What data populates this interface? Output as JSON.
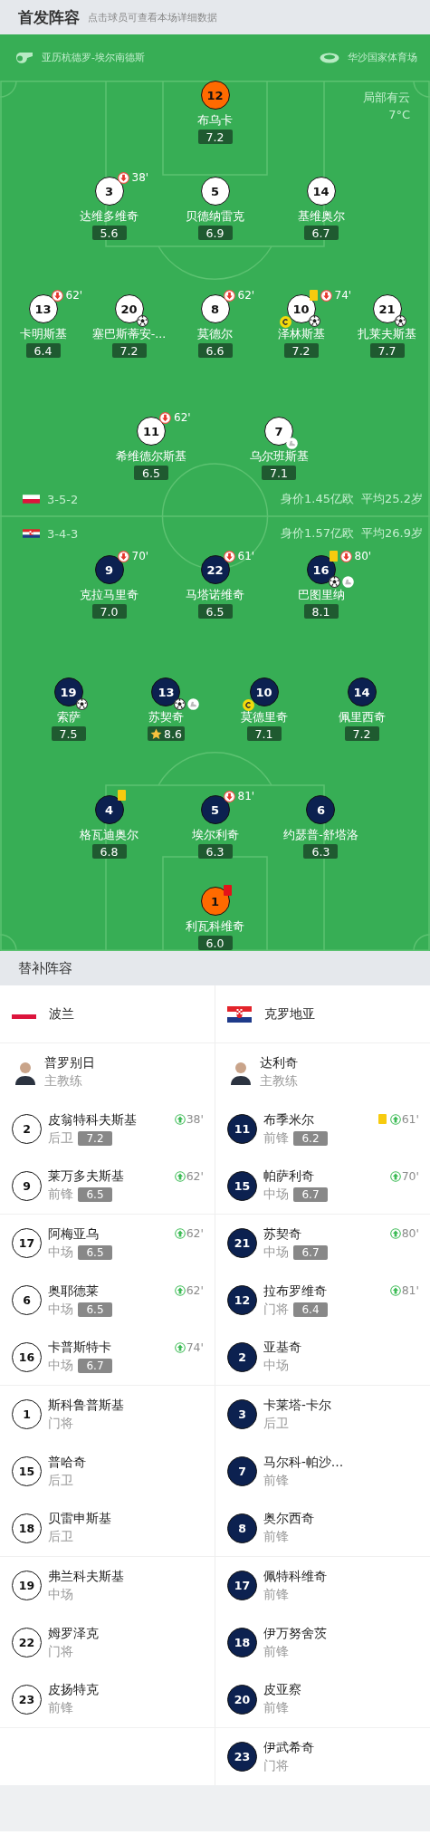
{
  "header": {
    "title": "首发阵容",
    "hint": "点击球员可查看本场详细数据"
  },
  "match_info": {
    "referee": "亚历杭德罗-埃尔南德斯",
    "stadium": "华沙国家体育场",
    "weather": "局部有云",
    "temperature": "7°C"
  },
  "teams": [
    {
      "kind": "home",
      "flag": {
        "kind": "poland"
      },
      "name": "波兰",
      "formation": "3-5-2",
      "value": "身价1.45亿欧",
      "avg_age": "平均25.2岁",
      "lines": [
        [
          {
            "number": "12",
            "name": "布乌卡",
            "rating": "7.2",
            "kind": "goalkeeper",
            "captain": false,
            "best": false
          }
        ],
        [
          {
            "number": "3",
            "name": "达维多维奇",
            "rating": "5.6",
            "kind": "outfield",
            "captain": false,
            "best": false,
            "events": [
              {
                "kind": "sub_off",
                "minute": "38'"
              }
            ]
          },
          {
            "number": "5",
            "name": "贝德纳雷克",
            "rating": "6.9",
            "kind": "outfield",
            "captain": false,
            "best": false
          },
          {
            "number": "14",
            "name": "基维奥尔",
            "rating": "6.7",
            "kind": "outfield",
            "captain": false,
            "best": false
          }
        ],
        [
          {
            "number": "13",
            "name": "卡明斯基",
            "rating": "6.4",
            "kind": "outfield",
            "captain": false,
            "best": false,
            "events": [
              {
                "kind": "sub_off",
                "minute": "62'"
              }
            ]
          },
          {
            "number": "20",
            "name": "塞巴斯蒂安-...",
            "rating": "7.2",
            "kind": "outfield",
            "captain": false,
            "best": false,
            "marks": [
              {
                "kind": "goal"
              }
            ]
          },
          {
            "number": "8",
            "name": "莫德尔",
            "rating": "6.6",
            "kind": "outfield",
            "captain": false,
            "best": false,
            "events": [
              {
                "kind": "sub_off",
                "minute": "62'"
              }
            ]
          },
          {
            "number": "10",
            "name": "泽林斯基",
            "rating": "7.2",
            "kind": "outfield",
            "captain": true,
            "best": false,
            "events": [
              {
                "kind": "yellow_card"
              },
              {
                "kind": "sub_off",
                "minute": "74'"
              }
            ],
            "marks": [
              {
                "kind": "goal"
              }
            ]
          },
          {
            "number": "21",
            "name": "扎莱夫斯基",
            "rating": "7.7",
            "kind": "outfield",
            "captain": false,
            "best": false,
            "marks": [
              {
                "kind": "goal"
              }
            ]
          }
        ],
        [
          {
            "number": "11",
            "name": "希维德尔斯基",
            "rating": "6.5",
            "kind": "outfield",
            "captain": false,
            "best": false,
            "events": [
              {
                "kind": "sub_off",
                "minute": "62'"
              }
            ]
          },
          {
            "number": "7",
            "name": "乌尔班斯基",
            "rating": "7.1",
            "kind": "outfield",
            "captain": false,
            "best": false,
            "marks": [
              {
                "kind": "assist"
              }
            ]
          }
        ]
      ],
      "coach": {
        "name": "普罗别日",
        "role": "主教练"
      },
      "subs": [
        {
          "number": "2",
          "name": "皮翁特科夫斯基",
          "position": "后卫",
          "rating": "7.2",
          "events": [
            {
              "kind": "sub_on",
              "minute": "38'"
            }
          ]
        },
        {
          "number": "9",
          "name": "莱万多夫斯基",
          "position": "前锋",
          "rating": "6.5",
          "events": [
            {
              "kind": "sub_on",
              "minute": "62'"
            }
          ]
        },
        {
          "number": "17",
          "name": "阿梅亚乌",
          "position": "中场",
          "rating": "6.5",
          "events": [
            {
              "kind": "sub_on",
              "minute": "62'"
            }
          ]
        },
        {
          "number": "6",
          "name": "奥耶德莱",
          "position": "中场",
          "rating": "6.5",
          "events": [
            {
              "kind": "sub_on",
              "minute": "62'"
            }
          ]
        },
        {
          "number": "16",
          "name": "卡普斯特卡",
          "position": "中场",
          "rating": "6.7",
          "events": [
            {
              "kind": "sub_on",
              "minute": "74'"
            }
          ]
        },
        {
          "number": "1",
          "name": "斯科鲁普斯基",
          "position": "门将"
        },
        {
          "number": "15",
          "name": "普哈奇",
          "position": "后卫"
        },
        {
          "number": "18",
          "name": "贝雷申斯基",
          "position": "后卫"
        },
        {
          "number": "19",
          "name": "弗兰科夫斯基",
          "position": "中场"
        },
        {
          "number": "22",
          "name": "姆罗泽克",
          "position": "门将"
        },
        {
          "number": "23",
          "name": "皮扬特克",
          "position": "前锋"
        }
      ]
    },
    {
      "kind": "away",
      "flag": {
        "kind": "croatia"
      },
      "name": "克罗地亚",
      "formation": "3-4-3",
      "value": "身价1.57亿欧",
      "avg_age": "平均26.9岁",
      "lines": [
        [
          {
            "number": "9",
            "name": "克拉马里奇",
            "rating": "7.0",
            "kind": "outfield",
            "captain": false,
            "best": false,
            "events": [
              {
                "kind": "sub_off",
                "minute": "70'"
              }
            ]
          },
          {
            "number": "22",
            "name": "马塔诺维奇",
            "rating": "6.5",
            "kind": "outfield",
            "captain": false,
            "best": false,
            "events": [
              {
                "kind": "sub_off",
                "minute": "61'"
              }
            ]
          },
          {
            "number": "16",
            "name": "巴图里纳",
            "rating": "8.1",
            "kind": "outfield",
            "captain": false,
            "best": false,
            "events": [
              {
                "kind": "yellow_card"
              },
              {
                "kind": "sub_off",
                "minute": "80'"
              }
            ],
            "marks": [
              {
                "kind": "goal"
              },
              {
                "kind": "assist"
              }
            ]
          }
        ],
        [
          {
            "number": "19",
            "name": "索萨",
            "rating": "7.5",
            "kind": "outfield",
            "captain": false,
            "best": false,
            "marks": [
              {
                "kind": "goal"
              }
            ]
          },
          {
            "number": "13",
            "name": "苏契奇",
            "rating": "8.6",
            "kind": "outfield",
            "captain": false,
            "best": true,
            "marks": [
              {
                "kind": "goal"
              },
              {
                "kind": "assist"
              }
            ]
          },
          {
            "number": "10",
            "name": "莫德里奇",
            "rating": "7.1",
            "kind": "outfield",
            "captain": true,
            "best": false
          },
          {
            "number": "14",
            "name": "佩里西奇",
            "rating": "7.2",
            "kind": "outfield",
            "captain": false,
            "best": false
          }
        ],
        [
          {
            "number": "4",
            "name": "格瓦迪奥尔",
            "rating": "6.8",
            "kind": "outfield",
            "captain": false,
            "best": false,
            "events": [
              {
                "kind": "yellow_card"
              }
            ]
          },
          {
            "number": "5",
            "name": "埃尔利奇",
            "rating": "6.3",
            "kind": "outfield",
            "captain": false,
            "best": false,
            "events": [
              {
                "kind": "sub_off",
                "minute": "81'"
              }
            ]
          },
          {
            "number": "6",
            "name": "约瑟普-舒塔洛",
            "rating": "6.3",
            "kind": "outfield",
            "captain": false,
            "best": false
          }
        ],
        [
          {
            "number": "1",
            "name": "利瓦科维奇",
            "rating": "6.0",
            "kind": "goalkeeper",
            "captain": false,
            "best": false,
            "events": [
              {
                "kind": "red_card"
              }
            ]
          }
        ]
      ],
      "coach": {
        "name": "达利奇",
        "role": "主教练"
      },
      "subs": [
        {
          "number": "11",
          "name": "布季米尔",
          "position": "前锋",
          "rating": "6.2",
          "events": [
            {
              "kind": "yellow_card"
            },
            {
              "kind": "sub_on",
              "minute": "61'"
            }
          ]
        },
        {
          "number": "15",
          "name": "帕萨利奇",
          "position": "中场",
          "rating": "6.7",
          "events": [
            {
              "kind": "sub_on",
              "minute": "70'"
            }
          ]
        },
        {
          "number": "21",
          "name": "苏契奇",
          "position": "中场",
          "rating": "6.7",
          "events": [
            {
              "kind": "sub_on",
              "minute": "80'"
            }
          ]
        },
        {
          "number": "12",
          "name": "拉布罗维奇",
          "position": "门将",
          "rating": "6.4",
          "events": [
            {
              "kind": "sub_on",
              "minute": "81'"
            }
          ]
        },
        {
          "number": "2",
          "name": "亚基奇",
          "position": "中场"
        },
        {
          "number": "3",
          "name": "卡莱塔-卡尔",
          "position": "后卫"
        },
        {
          "number": "7",
          "name": "马尔科-帕沙…",
          "position": "前锋"
        },
        {
          "number": "8",
          "name": "奥尔西奇",
          "position": "前锋"
        },
        {
          "number": "17",
          "name": "佩特科维奇",
          "position": "前锋"
        },
        {
          "number": "18",
          "name": "伊万努舍茨",
          "position": "前锋"
        },
        {
          "number": "20",
          "name": "皮亚察",
          "position": "前锋"
        },
        {
          "number": "23",
          "name": "伊武希奇",
          "position": "门将"
        }
      ]
    }
  ],
  "subs_header": {
    "title": "替补阵容"
  }
}
